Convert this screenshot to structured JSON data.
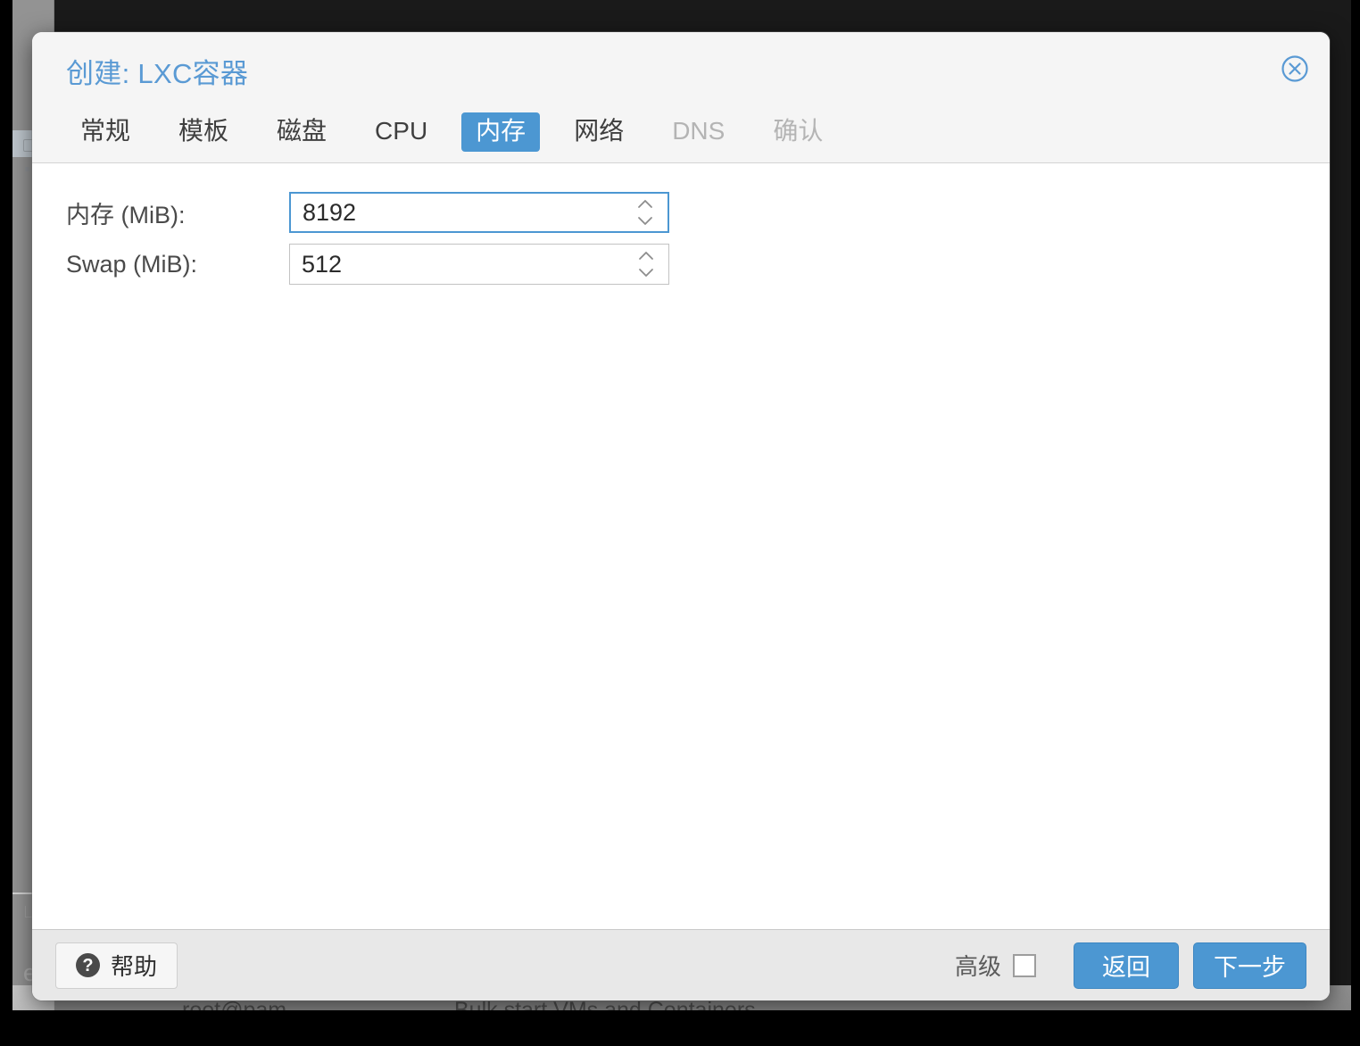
{
  "backdrop": {
    "status_text_left": "root@pam",
    "status_text_right": "Bulk start VMs and Containers",
    "sidebar_letter": "e"
  },
  "modal": {
    "title": "创建: LXC容器",
    "close_icon": "close-circle-icon",
    "tabs": [
      {
        "label": "常规",
        "state": "normal"
      },
      {
        "label": "模板",
        "state": "normal"
      },
      {
        "label": "磁盘",
        "state": "normal"
      },
      {
        "label": "CPU",
        "state": "normal"
      },
      {
        "label": "内存",
        "state": "active"
      },
      {
        "label": "网络",
        "state": "normal"
      },
      {
        "label": "DNS",
        "state": "disabled"
      },
      {
        "label": "确认",
        "state": "disabled"
      }
    ],
    "form": {
      "fields": [
        {
          "label": "内存 (MiB):",
          "value": "8192",
          "placeholder": "",
          "focused": true,
          "name": "memory-mib"
        },
        {
          "label": "Swap (MiB):",
          "value": "512",
          "placeholder": "",
          "focused": false,
          "name": "swap-mib"
        }
      ]
    },
    "footer": {
      "help_label": "帮助",
      "help_icon": "question-mark-icon",
      "advanced_label": "高级",
      "advanced_checked": false,
      "back_label": "返回",
      "next_label": "下一步"
    }
  },
  "colors": {
    "accent_blue": "#4c97d2",
    "title_blue": "#5a9ad4",
    "header_bg": "#f5f5f5",
    "footer_bg": "#e8e8e8",
    "body_bg": "#ffffff",
    "disabled_text": "#b4b4b4"
  }
}
